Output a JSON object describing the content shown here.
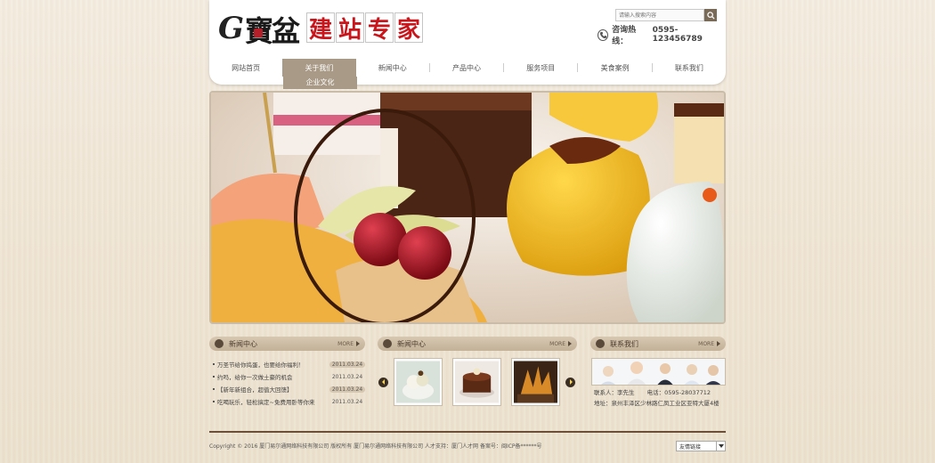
{
  "header": {
    "logo_letter": "G",
    "logo_brand": "寶盆",
    "slogan_chars": [
      "建",
      "站",
      "专",
      "家"
    ],
    "search_placeholder": "请输入搜索内容",
    "hotline_label": "咨询热线：",
    "hotline_number": "0595-123456789"
  },
  "nav": {
    "items": [
      "网站首页",
      "关于我们",
      "新闻中心",
      "产品中心",
      "服务项目",
      "美食案例",
      "联系我们"
    ],
    "active_index": 1,
    "submenu_item": "企业文化"
  },
  "sections": {
    "news": {
      "title": "新闻中心",
      "more": "MORE"
    },
    "gallery": {
      "title": "新闻中心",
      "more": "MORE"
    },
    "contact": {
      "title": "联系我们",
      "more": "MORE"
    }
  },
  "news_items": [
    {
      "title": "万圣节给你捣蛋，也要给你福利！",
      "date": "2011.03.24",
      "highlight": true
    },
    {
      "title": "约吗，给你一次做土豪的机会",
      "date": "2011.03.24",
      "highlight": false
    },
    {
      "title": "【新年新组合，超值大回馈】",
      "date": "2011.03.24",
      "highlight": true
    },
    {
      "title": "吃喝玩乐，轻松搞定~免费用卧等你来",
      "date": "2011.03.24",
      "highlight": false
    }
  ],
  "contact": {
    "person": "联系人：李先生",
    "phone": "电话：0595-28037712",
    "address": "地址：泉州丰泽区少林路仁凤工业区亚特大厦4楼"
  },
  "footer": {
    "copyright": "Copyright © 2016 厦门易尔通网络科技有限公司 版权所有 厦门易尔通网络科技有限公司 人才支持：厦门人才网 备案号：闽ICP备******号",
    "links_label": "友情链接"
  },
  "colors": {
    "accent": "#c8161d",
    "nav_active": "#a89a86",
    "footer_rule": "#6b4f38"
  },
  "icons": {
    "search": "search-icon",
    "phone": "phone-icon",
    "section": "section-bullet-icon",
    "prev": "arrow-left-icon",
    "next": "arrow-right-icon"
  }
}
